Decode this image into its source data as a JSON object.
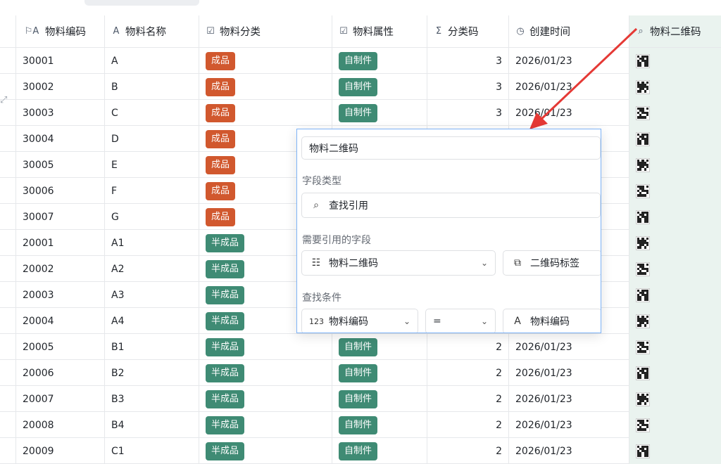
{
  "columns": [
    {
      "icon": "flag-text-icon",
      "glyph": "⚐ A",
      "label": "物料编码"
    },
    {
      "icon": "text-icon",
      "glyph": "A",
      "label": "物料名称"
    },
    {
      "icon": "select-icon",
      "glyph": "☑",
      "label": "物料分类"
    },
    {
      "icon": "select-icon",
      "glyph": "☑",
      "label": "物料属性"
    },
    {
      "icon": "sigma-icon",
      "glyph": "Σ",
      "label": "分类码"
    },
    {
      "icon": "clock-icon",
      "glyph": "◷",
      "label": "创建时间"
    },
    {
      "icon": "lookup-icon",
      "glyph": "⌕",
      "label": "物料二维码"
    }
  ],
  "rows": [
    {
      "code": "30001",
      "name": "A",
      "category": "成品",
      "attr": "自制件",
      "cat_code": "3",
      "created": "2026/01/23"
    },
    {
      "code": "30002",
      "name": "B",
      "category": "成品",
      "attr": "自制件",
      "cat_code": "3",
      "created": "2026/01/23"
    },
    {
      "code": "30003",
      "name": "C",
      "category": "成品",
      "attr": "自制件",
      "cat_code": "3",
      "created": "2026/01/23"
    },
    {
      "code": "30004",
      "name": "D",
      "category": "成品",
      "attr": "",
      "cat_code": "",
      "created": ""
    },
    {
      "code": "30005",
      "name": "E",
      "category": "成品",
      "attr": "",
      "cat_code": "",
      "created": ""
    },
    {
      "code": "30006",
      "name": "F",
      "category": "成品",
      "attr": "",
      "cat_code": "",
      "created": ""
    },
    {
      "code": "30007",
      "name": "G",
      "category": "成品",
      "attr": "",
      "cat_code": "",
      "created": ""
    },
    {
      "code": "20001",
      "name": "A1",
      "category": "半成品",
      "attr": "",
      "cat_code": "",
      "created": ""
    },
    {
      "code": "20002",
      "name": "A2",
      "category": "半成品",
      "attr": "",
      "cat_code": "",
      "created": ""
    },
    {
      "code": "20003",
      "name": "A3",
      "category": "半成品",
      "attr": "",
      "cat_code": "",
      "created": ""
    },
    {
      "code": "20004",
      "name": "A4",
      "category": "半成品",
      "attr": "",
      "cat_code": "",
      "created": ""
    },
    {
      "code": "20005",
      "name": "B1",
      "category": "半成品",
      "attr": "自制件",
      "cat_code": "2",
      "created": "2026/01/23"
    },
    {
      "code": "20006",
      "name": "B2",
      "category": "半成品",
      "attr": "自制件",
      "cat_code": "2",
      "created": "2026/01/23"
    },
    {
      "code": "20007",
      "name": "B3",
      "category": "半成品",
      "attr": "自制件",
      "cat_code": "2",
      "created": "2026/01/23"
    },
    {
      "code": "20008",
      "name": "B4",
      "category": "半成品",
      "attr": "自制件",
      "cat_code": "2",
      "created": "2026/01/23"
    },
    {
      "code": "20009",
      "name": "C1",
      "category": "半成品",
      "attr": "自制件",
      "cat_code": "2",
      "created": "2026/01/23"
    }
  ],
  "colors": {
    "finished": "#d1582e",
    "semi": "#3f8b74",
    "highlight_col": "#eaf3ef",
    "arrow": "#e53935"
  },
  "popup": {
    "field_name_value": "物料二维码",
    "field_type_label": "字段类型",
    "field_type_value": "查找引用",
    "ref_field_label": "需要引用的字段",
    "ref_table_value": "物料二维码",
    "ref_field_value": "二维码标签",
    "condition_label": "查找条件",
    "cond_field_value": "物料编码",
    "cond_operator_value": "=",
    "cond_target_value": "物料编码"
  }
}
